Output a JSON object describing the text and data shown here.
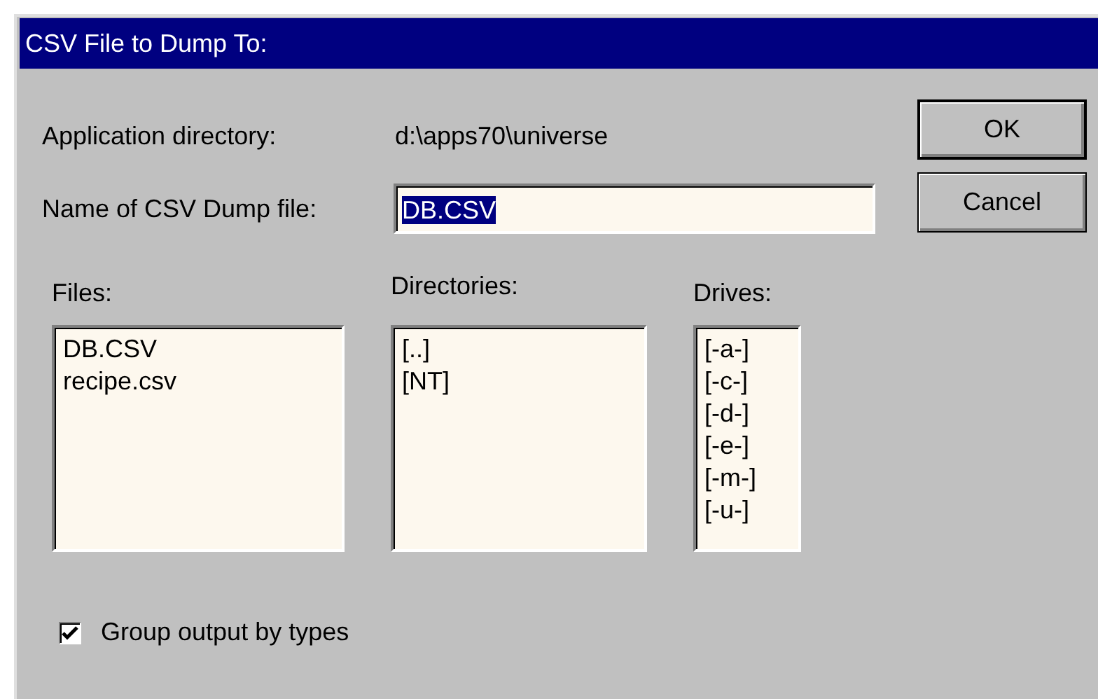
{
  "window": {
    "title": "CSV File to Dump To:"
  },
  "app_directory": {
    "label": "Application directory:",
    "value": "d:\\apps70\\universe"
  },
  "dump_file": {
    "label": "Name of CSV Dump file:",
    "value": "DB.CSV",
    "selected_text": true
  },
  "buttons": [
    {
      "label": "OK",
      "default": true
    },
    {
      "label": "Cancel",
      "default": false
    }
  ],
  "lists": [
    {
      "label": "Files:",
      "items": [
        "DB.CSV",
        "recipe.csv"
      ]
    },
    {
      "label": "Directories:",
      "items": [
        "[..]",
        "[NT]"
      ]
    },
    {
      "label": "Drives:",
      "items": [
        "[-a-]",
        "[-c-]",
        "[-d-]",
        "[-e-]",
        "[-m-]",
        "[-u-]"
      ]
    }
  ],
  "group_by_types": {
    "label": "Group output by types",
    "checked": true
  }
}
